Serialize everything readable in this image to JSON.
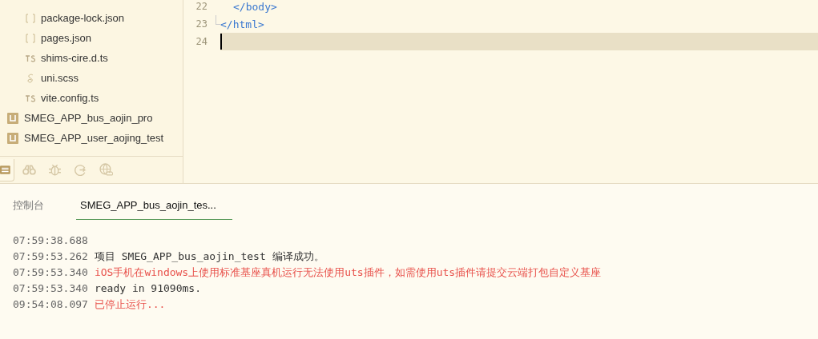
{
  "sidebar": {
    "files": [
      {
        "label": "package-lock.json",
        "kind": "json"
      },
      {
        "label": "pages.json",
        "kind": "json"
      },
      {
        "label": "shims-cire.d.ts",
        "kind": "ts"
      },
      {
        "label": "uni.scss",
        "kind": "scss"
      },
      {
        "label": "vite.config.ts",
        "kind": "ts"
      }
    ],
    "projects": [
      {
        "label": "SMEG_APP_bus_aojin_pro"
      },
      {
        "label": "SMEG_APP_user_aojing_test"
      }
    ],
    "tools": [
      {
        "kind": "list",
        "selected": true
      },
      {
        "kind": "binoculars",
        "selected": false
      },
      {
        "kind": "bug",
        "selected": false
      },
      {
        "kind": "refresh",
        "selected": false
      },
      {
        "kind": "globe",
        "selected": false
      }
    ]
  },
  "editor": {
    "lines": [
      {
        "number": "22",
        "indent": true,
        "code": "</body>",
        "current": false
      },
      {
        "number": "23",
        "indent": false,
        "code": "</html>",
        "current": false
      },
      {
        "number": "24",
        "current": true
      }
    ]
  },
  "console": {
    "tabs": [
      {
        "label": "控制台",
        "selected": false
      },
      {
        "label": "SMEG_APP_bus_aojin_tes...",
        "selected": true
      }
    ],
    "log": [
      {
        "time": "07:59:38.688"
      },
      {
        "time": "07:59:53.262",
        "message": "项目 SMEG_APP_bus_aojin_test 编译成功。",
        "kind": "info"
      },
      {
        "time": "07:59:53.340",
        "message": "iOS手机在windows上使用标准基座真机运行无法使用uts插件，如需使用uts插件请提交云端打包自定义基座",
        "kind": "error"
      },
      {
        "time": "07:59:53.340",
        "message": "ready in 91090ms.",
        "kind": "info"
      },
      {
        "time": "09:54:08.097",
        "message": "已停止运行...",
        "kind": "error"
      }
    ]
  }
}
